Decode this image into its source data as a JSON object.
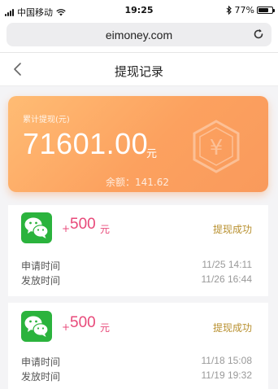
{
  "status_bar": {
    "carrier": "中国移动",
    "time": "19:25",
    "battery_pct": "77%",
    "battery_level": 0.77
  },
  "browser": {
    "url": "eimoney.com"
  },
  "nav": {
    "title": "提现记录"
  },
  "summary": {
    "label": "累计提现(元)",
    "amount": "71601.00",
    "unit": "元",
    "balance": "余额：141.62",
    "badge_symbol": "¥"
  },
  "records": [
    {
      "plus": "+",
      "amount": "500",
      "unit": "元",
      "status": "提现成功",
      "apply_label": "申请时间",
      "apply_time": "11/25 14:11",
      "issue_label": "发放时间",
      "issue_time": "11/26 16:44"
    },
    {
      "plus": "+",
      "amount": "500",
      "unit": "元",
      "status": "提现成功",
      "apply_label": "申请时间",
      "apply_time": "11/18 15:08",
      "issue_label": "发放时间",
      "issue_time": "11/19 19:32"
    }
  ],
  "colors": {
    "card_gradient_start": "#ffbc74",
    "card_gradient_end": "#f99a5c",
    "amount_pink": "#e84a7a",
    "status_gold": "#b8902f",
    "wechat_green": "#2bb33d"
  }
}
